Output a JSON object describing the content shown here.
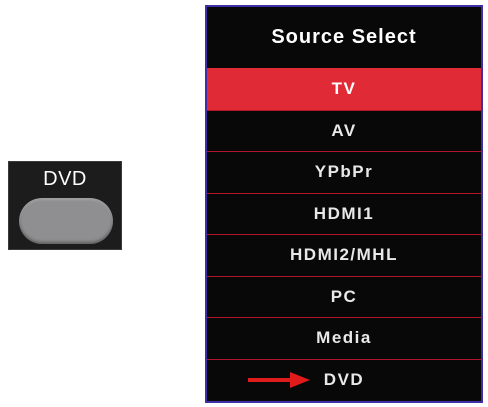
{
  "remote": {
    "key_label": "DVD"
  },
  "menu": {
    "title": "Source Select",
    "items": [
      {
        "label": "TV",
        "selected": true
      },
      {
        "label": "AV",
        "selected": false
      },
      {
        "label": "YPbPr",
        "selected": false
      },
      {
        "label": "HDMI1",
        "selected": false
      },
      {
        "label": "HDMI2/MHL",
        "selected": false
      },
      {
        "label": "PC",
        "selected": false
      },
      {
        "label": "Media",
        "selected": false
      },
      {
        "label": "DVD",
        "selected": false,
        "pointed": true
      }
    ]
  },
  "colors": {
    "highlight": "#e02a36",
    "menu_background": "#0b0b0b",
    "menu_border": "#3e2fa8",
    "divider": "#b0182a",
    "arrow": "#e01b1b",
    "key_button": "#8f8f91"
  },
  "icons": {
    "pointer": "right-arrow-icon"
  }
}
